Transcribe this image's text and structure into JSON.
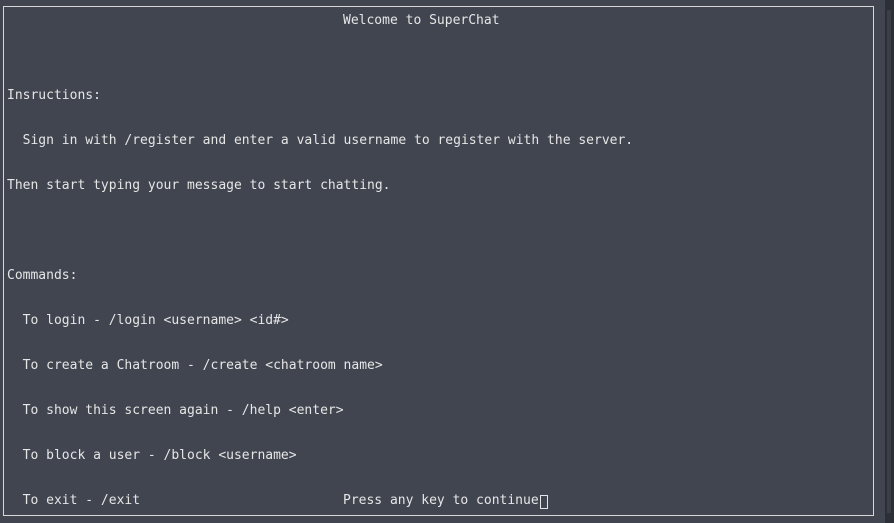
{
  "header": {
    "title": "Welcome to SuperChat"
  },
  "instructions": {
    "label": "Insructions:",
    "line1": "  Sign in with /register and enter a valid username to register with the server.",
    "line2": "Then start typing your message to start chatting."
  },
  "commands": {
    "label": "Commands:",
    "items": [
      "  To login - /login <username> <id#>",
      "  To create a Chatroom - /create <chatroom name>",
      "  To show this screen again - /help <enter>",
      "  To block a user - /block <username>",
      "  To exit - /exit"
    ]
  },
  "footer": {
    "prompt": "Press any key to continue"
  },
  "colors": {
    "background": "#404550",
    "text": "#e6e6e6",
    "border": "#d7d7d7"
  }
}
